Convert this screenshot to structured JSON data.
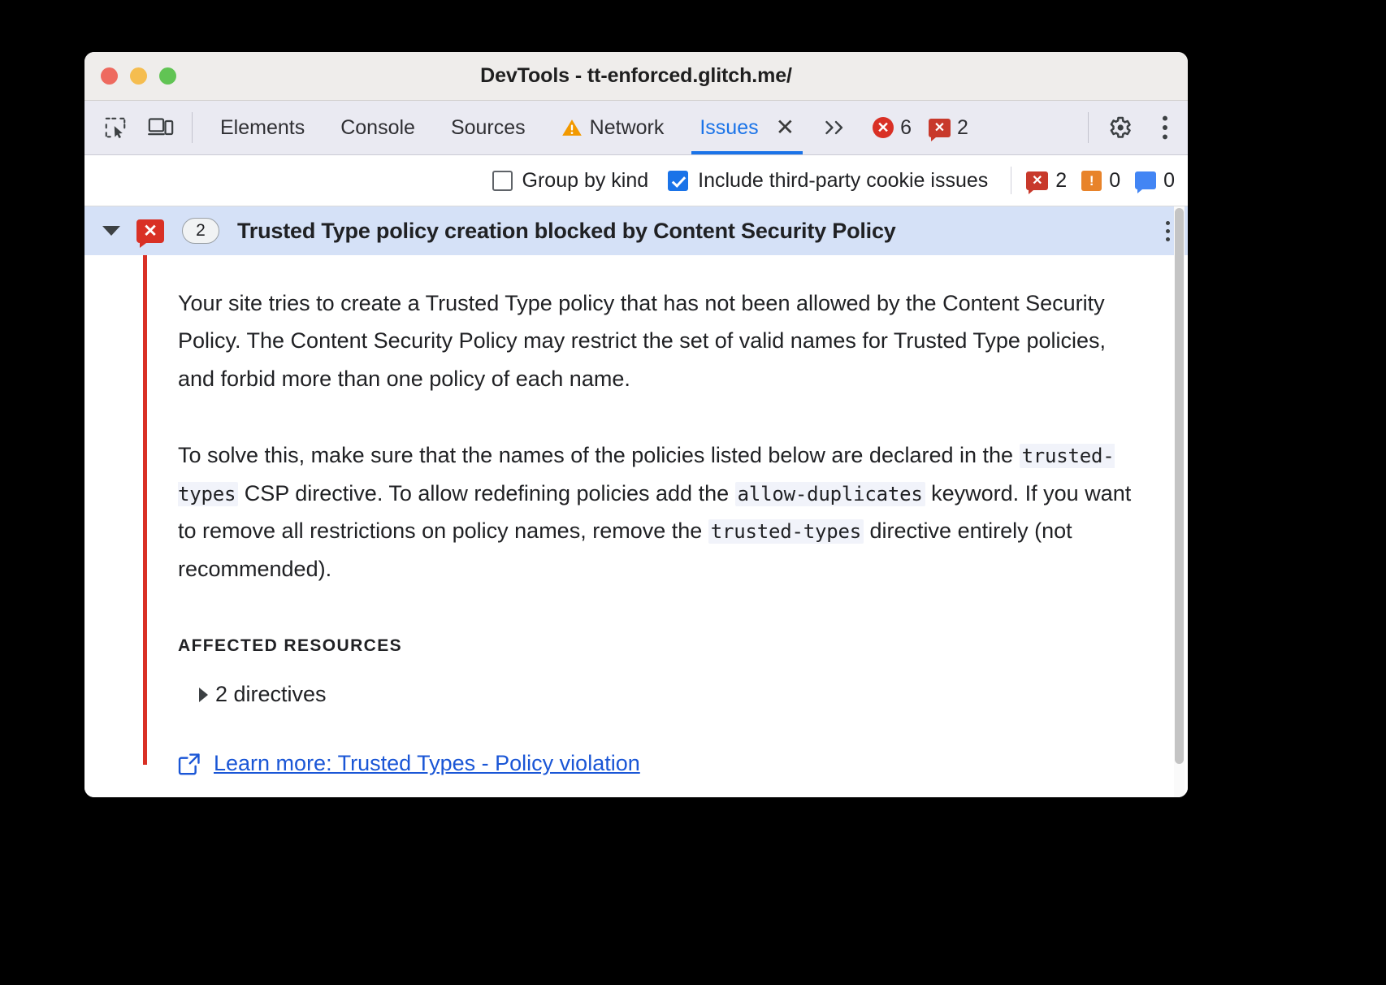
{
  "window": {
    "title": "DevTools - tt-enforced.glitch.me/",
    "traffic_lights": [
      "close-red",
      "minimize-yellow",
      "zoom-green"
    ]
  },
  "tabbar": {
    "inspect_icon": "inspect-element-icon",
    "device_icon": "device-toolbar-icon",
    "tabs": [
      {
        "label": "Elements",
        "active": false,
        "icon": null
      },
      {
        "label": "Console",
        "active": false,
        "icon": null
      },
      {
        "label": "Sources",
        "active": false,
        "icon": null
      },
      {
        "label": "Network",
        "active": false,
        "icon": "warning-triangle-icon"
      },
      {
        "label": "Issues",
        "active": true,
        "icon": null
      }
    ],
    "close_tab_label": "✕",
    "more_tabs_label": "»",
    "counters": [
      {
        "type": "errors",
        "value": "6",
        "color": "#d93025"
      },
      {
        "type": "issues",
        "value": "2",
        "color": "#c8392b"
      }
    ],
    "settings_icon": "gear-icon",
    "menu_icon": "kebab-menu-icon"
  },
  "filterbar": {
    "group_by_kind": {
      "label": "Group by kind",
      "checked": false
    },
    "third_party": {
      "label": "Include third-party cookie issues",
      "checked": true
    },
    "counts": [
      {
        "type": "issue",
        "value": "2",
        "color": "#c8392b"
      },
      {
        "type": "warning",
        "value": "0",
        "color": "#e8832a"
      },
      {
        "type": "info",
        "value": "0",
        "color": "#4285f4"
      }
    ]
  },
  "issue": {
    "expanded": true,
    "severity_icon": "issue-error-icon",
    "count_badge": "2",
    "title": "Trusted Type policy creation blocked by Content Security Policy",
    "kebab_icon": "kebab-menu-icon",
    "paragraph1": "Your site tries to create a Trusted Type policy that has not been allowed by the Content Security Policy. The Content Security Policy may restrict the set of valid names for Trusted Type policies, and forbid more than one policy of each name.",
    "paragraph2": {
      "part1": "To solve this, make sure that the names of the policies listed below are declared in the ",
      "code1": "trusted-types",
      "part2": " CSP directive. To allow redefining policies add the ",
      "code2": "allow-duplicates",
      "part3": " keyword. If you want to remove all restrictions on policy names, remove the ",
      "code3": "trusted-types",
      "part4": " directive entirely (not recommended)."
    },
    "affected_resources_label": "AFFECTED RESOURCES",
    "directives_label": "2 directives",
    "learn_more": {
      "icon": "external-link-icon",
      "label": "Learn more: Trusted Types - Policy violation"
    }
  },
  "colors": {
    "accent": "#1a73e8",
    "error": "#d93025",
    "warning": "#e8832a",
    "info": "#4285f4",
    "issue_header_bg": "#d5e1f7",
    "link": "#1a56d6"
  }
}
